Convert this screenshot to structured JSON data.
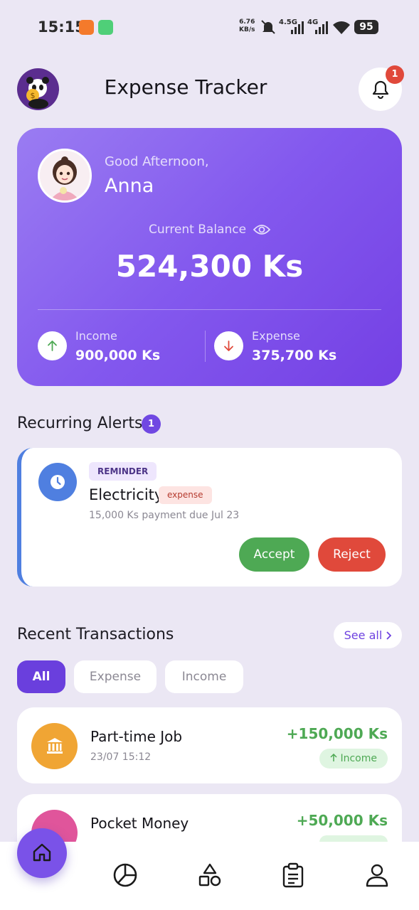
{
  "status_bar": {
    "time": "15:15",
    "net_speed_value": "6.76",
    "net_speed_unit": "KB/s",
    "signal_1": "4.5G",
    "signal_2": "4G",
    "battery": "95"
  },
  "header": {
    "title": "Expense Tracker",
    "notification_count": "1"
  },
  "balance_card": {
    "greeting": "Good Afternoon,",
    "user_name": "Anna",
    "balance_label": "Current Balance",
    "balance_value": "524,300 Ks",
    "income_label": "Income",
    "income_value": "900,000 Ks",
    "expense_label": "Expense",
    "expense_value": "375,700 Ks"
  },
  "recurring": {
    "title": "Recurring Alerts",
    "count": "1",
    "alert": {
      "tag": "REMINDER",
      "name": "Electricity",
      "type": "expense",
      "description": "15,000 Ks payment due Jul 23",
      "accept_label": "Accept",
      "reject_label": "Reject"
    }
  },
  "transactions": {
    "title": "Recent Transactions",
    "see_all": "See all",
    "filters": [
      "All",
      "Expense",
      "Income"
    ],
    "items": [
      {
        "name": "Part-time Job",
        "date": "23/07  15:12",
        "amount": "+150,000 Ks",
        "type_label": "Income"
      },
      {
        "name": "Pocket Money",
        "amount": "+50,000 Ks"
      }
    ]
  },
  "colors": {
    "accent": "#7048e2",
    "income_green": "#4ea954",
    "expense_red": "#e0493b",
    "reminder_blue": "#4f7fe0"
  }
}
